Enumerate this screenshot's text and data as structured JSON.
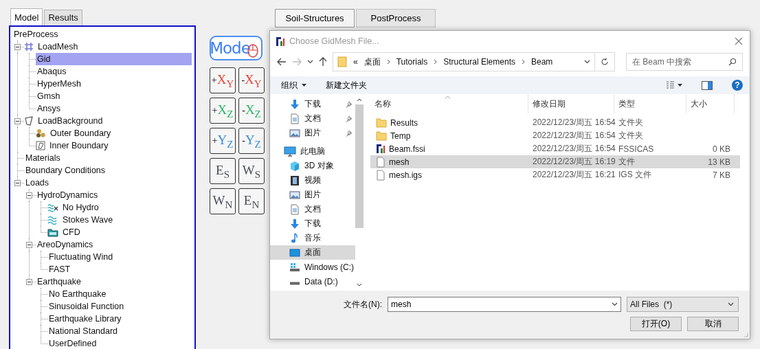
{
  "left_tabs": [
    {
      "label": "Model",
      "selected": true
    },
    {
      "label": "Results",
      "selected": false
    }
  ],
  "tree": {
    "label": "PreProcess",
    "selected": false,
    "children": [
      {
        "label": "LoadMesh",
        "kind": "mesh",
        "selected": false,
        "expanded": true,
        "children": [
          {
            "label": "Gid",
            "selected": true
          },
          {
            "label": "Abaqus",
            "selected": false
          },
          {
            "label": "HyperMesh",
            "selected": false
          },
          {
            "label": "Gmsh",
            "selected": false
          },
          {
            "label": "Ansys",
            "selected": false
          }
        ]
      },
      {
        "label": "LoadBackground",
        "kind": "polygon",
        "selected": false,
        "expanded": true,
        "children": [
          {
            "label": "Outer Boundary",
            "kind": "shapes",
            "selected": false
          },
          {
            "label": "Inner Boundary",
            "kind": "boundary",
            "selected": false
          }
        ]
      },
      {
        "label": "Materials",
        "selected": false
      },
      {
        "label": "Boundary Conditions",
        "selected": false
      },
      {
        "label": "Loads",
        "selected": false,
        "expanded": true,
        "children": [
          {
            "label": "HydroDynamics",
            "selected": false,
            "expanded": true,
            "children": [
              {
                "label": "No Hydro",
                "kind": "nowave",
                "selected": false
              },
              {
                "label": "Stokes Wave",
                "kind": "wave",
                "selected": false
              },
              {
                "label": "CFD",
                "kind": "folder",
                "selected": false
              }
            ]
          },
          {
            "label": "AreoDynamics",
            "selected": false,
            "expanded": true,
            "children": [
              {
                "label": "Fluctuating Wind",
                "selected": false
              },
              {
                "label": "FAST",
                "selected": false
              }
            ]
          },
          {
            "label": "Earthquake",
            "selected": false,
            "expanded": true,
            "children": [
              {
                "label": "No Earthquake",
                "selected": false
              },
              {
                "label": "Sinusoidal Function",
                "selected": false
              },
              {
                "label": "Earthquake Library",
                "selected": false
              },
              {
                "label": "National Standard",
                "selected": false
              },
              {
                "label": "UserDefined",
                "selected": false
              }
            ]
          }
        ]
      }
    ]
  },
  "mode_logo": {
    "label": "Mode"
  },
  "view_buttons": [
    {
      "prefix": "+",
      "main": "X",
      "sub": "Y",
      "color": "#e2463c"
    },
    {
      "prefix": "-",
      "main": "X",
      "sub": "Y",
      "color": "#e2463c"
    },
    {
      "prefix": "+",
      "main": "X",
      "sub": "Z",
      "color": "#2fb56a"
    },
    {
      "prefix": "-",
      "main": "X",
      "sub": "Z",
      "color": "#2fb56a"
    },
    {
      "prefix": "+",
      "main": "Y",
      "sub": "Z",
      "color": "#3b8fd8"
    },
    {
      "prefix": "-",
      "main": "Y",
      "sub": "Z",
      "color": "#3b8fd8"
    },
    {
      "main": "E",
      "sub": "S",
      "color": "#4a4f5a"
    },
    {
      "main": "W",
      "sub": "S",
      "color": "#4a4f5a"
    },
    {
      "main": "W",
      "sub": "N",
      "color": "#4a4f5a"
    },
    {
      "main": "E",
      "sub": "N",
      "color": "#4a4f5a"
    }
  ],
  "right_tabs": [
    {
      "label": "Soil-Structures",
      "selected": true
    },
    {
      "label": "PostProcess",
      "selected": false
    }
  ],
  "dialog": {
    "title": "Choose GidMesh File...",
    "address": {
      "overflow": "«",
      "path": [
        "桌面",
        "Tutorials",
        "Structural Elements",
        "Beam"
      ]
    },
    "search": {
      "placeholder": "在 Beam 中搜索"
    },
    "toolbar": {
      "organize": "组织",
      "new_folder": "新建文件夹",
      "help": "?"
    },
    "quick_access": [
      {
        "label": "下载",
        "kind": "download",
        "pinned": true,
        "selected": false
      },
      {
        "label": "文档",
        "kind": "document",
        "pinned": true,
        "selected": false
      },
      {
        "label": "图片",
        "kind": "pictures",
        "pinned": true,
        "selected": false
      }
    ],
    "this_pc": {
      "label": "此电脑",
      "selected": false,
      "children": [
        {
          "label": "3D 对象",
          "kind": "cube",
          "selected": false
        },
        {
          "label": "视频",
          "kind": "video",
          "selected": false
        },
        {
          "label": "图片",
          "kind": "pictures",
          "selected": false
        },
        {
          "label": "文档",
          "kind": "document",
          "selected": false
        },
        {
          "label": "下载",
          "kind": "download",
          "selected": false
        },
        {
          "label": "音乐",
          "kind": "music",
          "selected": false
        },
        {
          "label": "桌面",
          "kind": "desktop",
          "selected": true
        },
        {
          "label": "Windows (C:)",
          "kind": "system-drive",
          "selected": false
        },
        {
          "label": "Data (D:)",
          "kind": "drive",
          "selected": false
        }
      ]
    },
    "columns": [
      "名称",
      "修改日期",
      "类型",
      "大小"
    ],
    "files": [
      {
        "name": "Results",
        "modified": "2022/12/23/周五 16:54",
        "type": "文件夹",
        "kind": "folder",
        "selected": false
      },
      {
        "name": "Temp",
        "modified": "2022/12/23/周五 16:54",
        "type": "文件夹",
        "kind": "folder",
        "selected": false
      },
      {
        "name": "Beam.fssi",
        "modified": "2022/12/23/周五 16:54",
        "type": "FSSICAS",
        "size": "0 KB",
        "kind": "app",
        "selected": false
      },
      {
        "name": "mesh",
        "modified": "2022/12/23/周五 16:19",
        "type": "文件",
        "size": "13 KB",
        "kind": "file",
        "selected": true
      },
      {
        "name": "mesh.igs",
        "modified": "2022/12/23/周五 16:21",
        "type": "IGS 文件",
        "size": "7 KB",
        "kind": "file",
        "selected": false
      }
    ],
    "filename": {
      "label": "文件名(N):",
      "value": "mesh"
    },
    "filter": {
      "value": "All Files  (*)"
    },
    "buttons": [
      "打开(O)",
      "取消"
    ]
  }
}
